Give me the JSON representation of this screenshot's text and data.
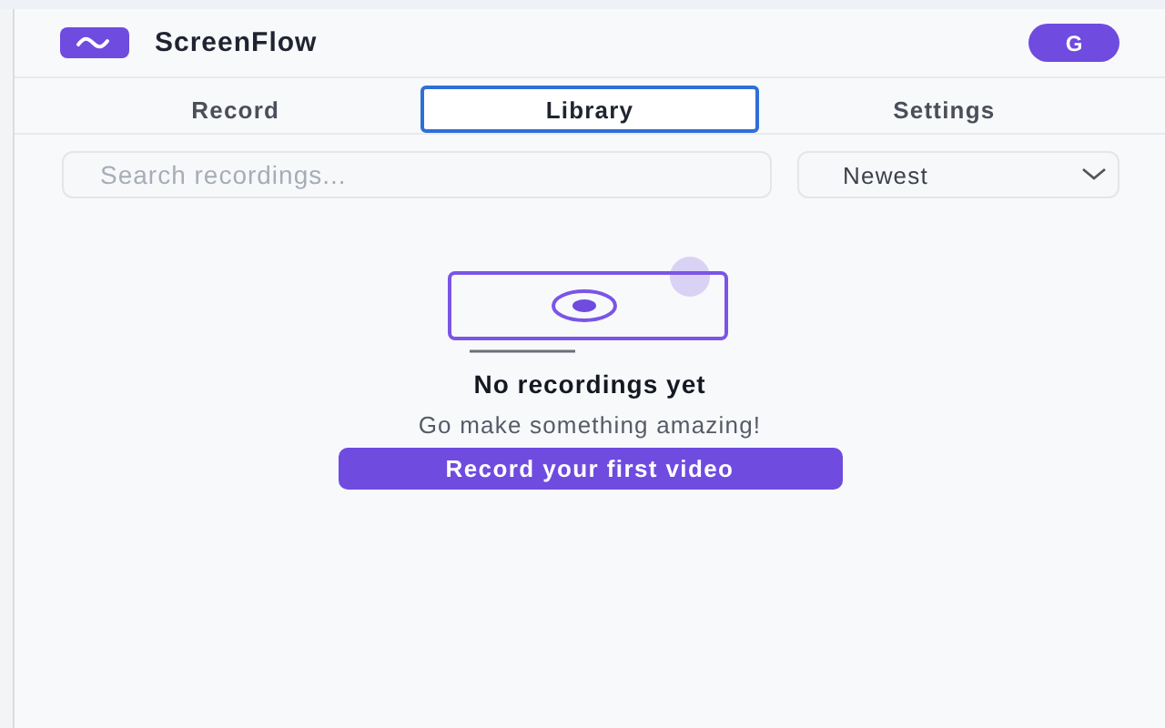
{
  "header": {
    "app_name": "ScreenFlow",
    "avatar": "G"
  },
  "tabs": [
    {
      "label": "Record",
      "selected": false
    },
    {
      "label": "Library",
      "selected": true
    },
    {
      "label": "Settings",
      "selected": false
    }
  ],
  "search": {
    "placeholder": "Search recordings..."
  },
  "sort": {
    "value": "Newest"
  },
  "empty_state": {
    "title": "No recordings yet",
    "subtitle": "Go make something amazing!",
    "button": "Record your first video"
  }
}
